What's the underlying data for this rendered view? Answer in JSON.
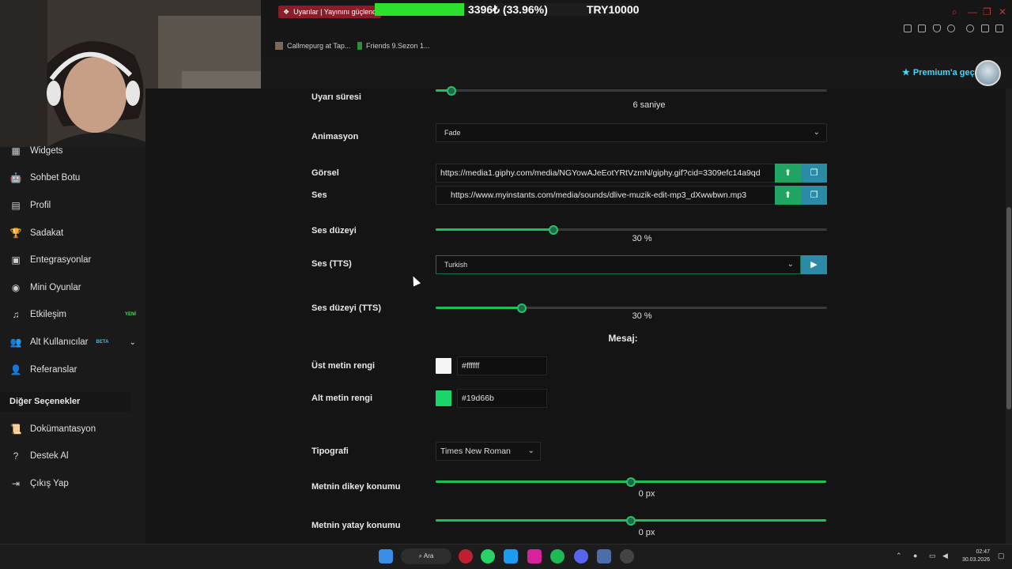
{
  "overlay": {
    "badge_text": "Uyarılar | Yayınını güçlend",
    "amount_text": "3396₺ (33.96%)",
    "goal_text": "TRY10000",
    "progress_percent": 33.96
  },
  "bookmarks": [
    {
      "label": "Callmepurg at Tap..."
    },
    {
      "label": "Friends 9.Sezon 1..."
    }
  ],
  "header": {
    "premium_label": "Premium'a geç"
  },
  "sidebar": {
    "items": [
      {
        "label": "Widgets",
        "icon": "grid-icon"
      },
      {
        "label": "Sohbet Botu",
        "icon": "robot-icon"
      },
      {
        "label": "Profil",
        "icon": "id-card-icon"
      },
      {
        "label": "Sadakat",
        "icon": "trophy-icon"
      },
      {
        "label": "Entegrasyonlar",
        "icon": "plug-icon"
      },
      {
        "label": "Mini Oyunlar",
        "icon": "gamepad-icon"
      },
      {
        "label": "Etkileşim",
        "icon": "music-icon",
        "badge": "YENİ"
      },
      {
        "label": "Alt Kullanıcılar",
        "icon": "users-icon",
        "badge": "BETA"
      },
      {
        "label": "Referanslar",
        "icon": "user-group-icon"
      }
    ],
    "section_title": "Diğer Seçenekler",
    "other_items": [
      {
        "label": "Dokümantasyon",
        "icon": "scroll-icon"
      },
      {
        "label": "Destek Al",
        "icon": "question-icon"
      },
      {
        "label": "Çıkış Yap",
        "icon": "logout-icon"
      }
    ]
  },
  "form": {
    "alert_duration": {
      "label": "Uyarı süresi",
      "value": 6,
      "value_text": "6 saniye",
      "fraction": 0.04
    },
    "animation": {
      "label": "Animasyon",
      "selected": "Fade"
    },
    "image": {
      "label": "Görsel",
      "value": "https://media1.giphy.com/media/NGYowAJeEotYRtVzmN/giphy.gif?cid=3309efc14a9qd"
    },
    "sound": {
      "label": "Ses",
      "value": "https://www.myinstants.com/media/sounds/dlive-muzik-edit-mp3_dXwwbwn.mp3"
    },
    "volume": {
      "label": "Ses düzeyi",
      "value": 30,
      "value_text": "30 %",
      "fraction": 0.3
    },
    "tts": {
      "label": "Ses (TTS)",
      "selected": "Turkish"
    },
    "tts_volume": {
      "label": "Ses düzeyi (TTS)",
      "value": 30,
      "value_text": "30 %",
      "fraction": 0.22
    },
    "message_heading": "Mesaj:",
    "top_text_color": {
      "label": "Üst metin rengi",
      "value": "#ffffff",
      "swatch": "#f5f5f5"
    },
    "bottom_text_color": {
      "label": "Alt metin rengi",
      "value": "#19d66b",
      "swatch": "#19d66b"
    },
    "typography": {
      "label": "Tipografi",
      "selected": "Times New Roman"
    },
    "vertical_pos": {
      "label": "Metnin dikey konumu",
      "value": 0,
      "value_text": "0 px",
      "fraction": 0.5
    },
    "horizontal_pos": {
      "label": "Metnin yatay konumu",
      "value": 0,
      "value_text": "0 px",
      "fraction": 0.5
    }
  },
  "taskbar": {
    "search_label": "Ara",
    "time": "02:47",
    "date": "30.03.2026"
  },
  "colors": {
    "accent_green": "#1fbf5a",
    "accent_blue": "#2b8aa6",
    "premium": "#40d9ff"
  }
}
